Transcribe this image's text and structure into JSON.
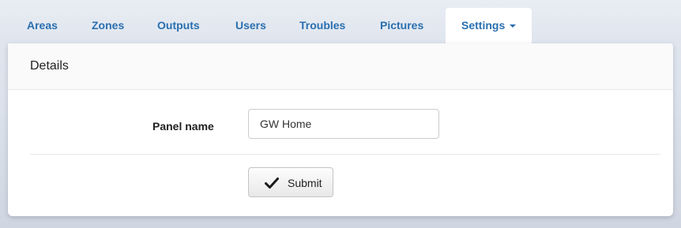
{
  "nav": {
    "tabs": [
      {
        "label": "Areas"
      },
      {
        "label": "Zones"
      },
      {
        "label": "Outputs"
      },
      {
        "label": "Users"
      },
      {
        "label": "Troubles"
      },
      {
        "label": "Pictures"
      },
      {
        "label": "Settings",
        "active": true,
        "icon": "caret-down-icon"
      }
    ]
  },
  "panel": {
    "title": "Details",
    "form": {
      "panel_name_label": "Panel name",
      "panel_name_value": "GW Home",
      "submit_label": "Submit",
      "submit_icon": "checkmark-icon"
    }
  },
  "colors": {
    "link": "#2a6fb0",
    "panel_bg": "#ffffff",
    "page_bg": "#dde3ec"
  }
}
